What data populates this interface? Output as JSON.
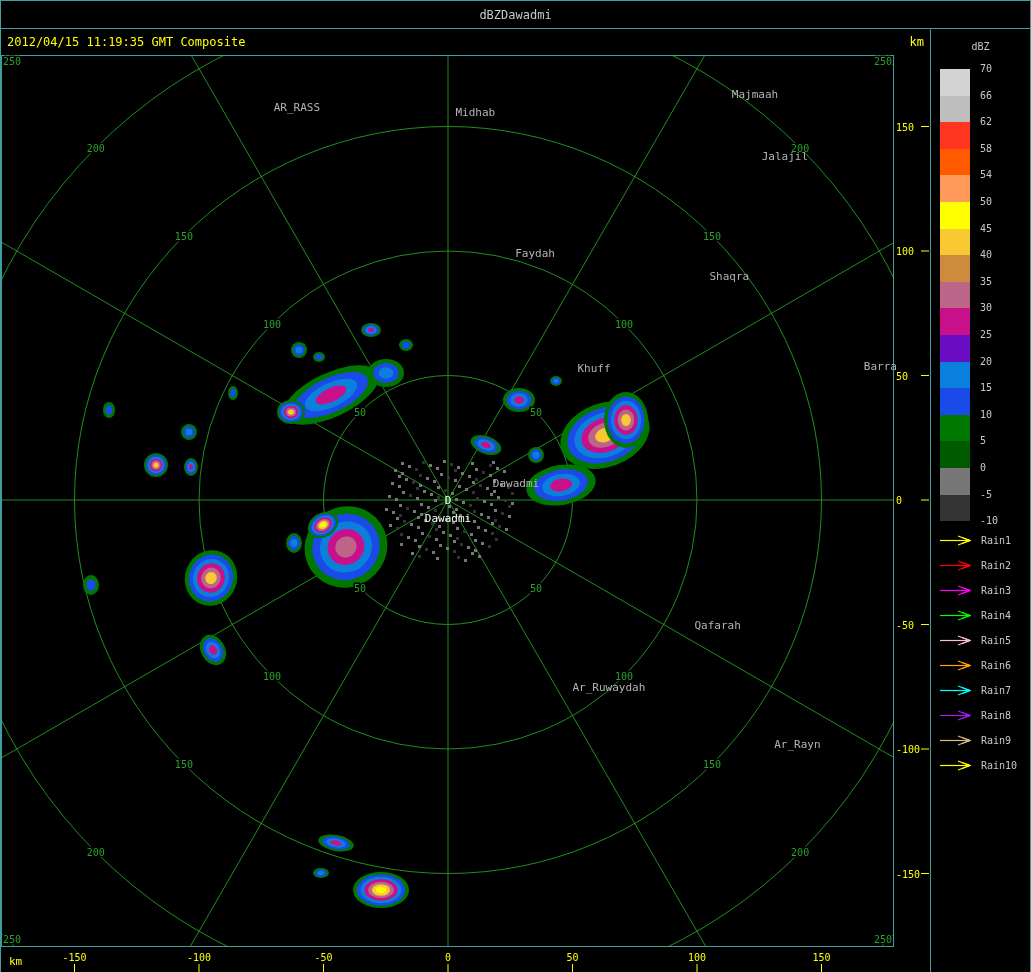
{
  "window": {
    "title": "dBZDawadmi"
  },
  "header": {
    "timestamp": "2012/04/15 11:19:35 GMT Composite",
    "unit": "km"
  },
  "map": {
    "range_labels": [
      {
        "labels": [
          "50",
          "100",
          "150",
          "200",
          "250"
        ]
      },
      {
        "labels": [
          "50",
          "100",
          "150",
          "200",
          "250"
        ]
      },
      {
        "labels": [
          "50",
          "100",
          "150",
          "200",
          "250"
        ]
      },
      {
        "labels": [
          "50",
          "100",
          "150",
          "200",
          "250"
        ]
      }
    ],
    "station": {
      "marker": "D",
      "name": "Dawadmi"
    },
    "places": [
      {
        "name": "AR_RASS"
      },
      {
        "name": "Midhab"
      },
      {
        "name": "Majmaah"
      },
      {
        "name": "Jalajil"
      },
      {
        "name": "Faydah"
      },
      {
        "name": "Shaqra"
      },
      {
        "name": "Khuff"
      },
      {
        "name": "Barra"
      },
      {
        "name": "Dawadmi"
      },
      {
        "name": "Qafarah"
      },
      {
        "name": "Ar_Ruwaydah"
      },
      {
        "name": "Ar_Rayn"
      }
    ]
  },
  "y_axis": {
    "labels": [
      "150",
      "100",
      "50",
      "0",
      "-50",
      "-100",
      "-150"
    ]
  },
  "x_axis": {
    "unit": "km",
    "labels": [
      "-150",
      "-100",
      "-50",
      "0",
      "50",
      "100",
      "150"
    ]
  },
  "legend": {
    "title": "dBZ",
    "bins": [
      {
        "color": "#d3d3d3"
      },
      {
        "color": "#bebebe"
      },
      {
        "color": "#ff3520"
      },
      {
        "color": "#ff5a00"
      },
      {
        "color": "#ff9a5a"
      },
      {
        "color": "#ffff00"
      },
      {
        "color": "#fac832"
      },
      {
        "color": "#cd8b3e"
      },
      {
        "color": "#bb6688"
      },
      {
        "color": "#c8108a"
      },
      {
        "color": "#6a0dc4"
      },
      {
        "color": "#0a80dc"
      },
      {
        "color": "#1a4ae8"
      },
      {
        "color": "#007800"
      },
      {
        "color": "#005a00"
      },
      {
        "color": "#777777"
      },
      {
        "color": "#333333"
      }
    ],
    "ticks": [
      "70",
      "66",
      "62",
      "58",
      "54",
      "50",
      "45",
      "40",
      "35",
      "30",
      "25",
      "20",
      "15",
      "10",
      "5",
      "0",
      "-5",
      "-10"
    ]
  },
  "tracks": [
    {
      "label": "Rain1",
      "color": "#ffff00"
    },
    {
      "label": "Rain2",
      "color": "#ff0000"
    },
    {
      "label": "Rain3",
      "color": "#ff00ff"
    },
    {
      "label": "Rain4",
      "color": "#00ff00"
    },
    {
      "label": "Rain5",
      "color": "#ffc0cb"
    },
    {
      "label": "Rain6",
      "color": "#ffa500"
    },
    {
      "label": "Rain7",
      "color": "#00ffff"
    },
    {
      "label": "Rain8",
      "color": "#a020f0"
    },
    {
      "label": "Rain9",
      "color": "#deb887"
    },
    {
      "label": "Rain10",
      "color": "#ffff00"
    }
  ]
}
